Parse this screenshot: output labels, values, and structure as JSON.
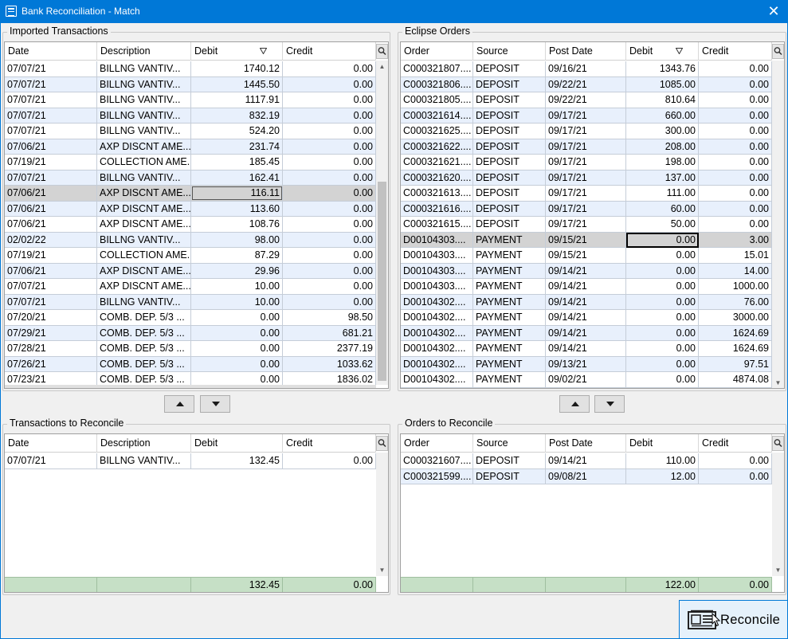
{
  "window": {
    "title": "Bank Reconciliation - Match",
    "close_icon": "close-icon"
  },
  "imported": {
    "legend": "Imported Transactions",
    "columns": [
      "Date",
      "Description",
      "Debit",
      "Credit"
    ],
    "sort_column": "Debit",
    "rows": [
      [
        "07/07/21",
        "BILLNG      VANTIV...",
        "1740.12",
        "0.00"
      ],
      [
        "07/07/21",
        "BILLNG      VANTIV...",
        "1445.50",
        "0.00"
      ],
      [
        "07/07/21",
        "BILLNG      VANTIV...",
        "1117.91",
        "0.00"
      ],
      [
        "07/07/21",
        "BILLNG      VANTIV...",
        "832.19",
        "0.00"
      ],
      [
        "07/07/21",
        "BILLNG      VANTIV...",
        "524.20",
        "0.00"
      ],
      [
        "07/06/21",
        "AXP DISCNT AME...",
        "231.74",
        "0.00"
      ],
      [
        "07/19/21",
        "COLLECTION AME...",
        "185.45",
        "0.00"
      ],
      [
        "07/07/21",
        "BILLNG      VANTIV...",
        "162.41",
        "0.00"
      ],
      [
        "07/06/21",
        "AXP DISCNT AME...",
        "116.11",
        "0.00"
      ],
      [
        "07/06/21",
        "AXP DISCNT AME...",
        "113.60",
        "0.00"
      ],
      [
        "07/06/21",
        "AXP DISCNT AME...",
        "108.76",
        "0.00"
      ],
      [
        "02/02/22",
        "BILLNG      VANTIV...",
        "98.00",
        "0.00"
      ],
      [
        "07/19/21",
        "COLLECTION AME...",
        "87.29",
        "0.00"
      ],
      [
        "07/06/21",
        "AXP DISCNT AME...",
        "29.96",
        "0.00"
      ],
      [
        "07/07/21",
        "AXP DISCNT AME...",
        "10.00",
        "0.00"
      ],
      [
        "07/07/21",
        "BILLNG      VANTIV...",
        "10.00",
        "0.00"
      ],
      [
        "07/20/21",
        "COMB. DEP. 5/3 ...",
        "0.00",
        "98.50"
      ],
      [
        "07/29/21",
        "COMB. DEP. 5/3 ...",
        "0.00",
        "681.21"
      ],
      [
        "07/28/21",
        "COMB. DEP. 5/3 ...",
        "0.00",
        "2377.19"
      ],
      [
        "07/26/21",
        "COMB. DEP. 5/3 ...",
        "0.00",
        "1033.62"
      ],
      [
        "07/23/21",
        "COMB. DEP. 5/3 ...",
        "0.00",
        "1836.02"
      ]
    ],
    "selected_row": 8
  },
  "eclipse": {
    "legend": "Eclipse Orders",
    "columns": [
      "Order",
      "Source",
      "Post Date",
      "Debit",
      "Credit"
    ],
    "sort_column": "Debit",
    "rows": [
      [
        "C000321807....",
        "DEPOSIT",
        "09/16/21",
        "1343.76",
        "0.00"
      ],
      [
        "C000321806....",
        "DEPOSIT",
        "09/22/21",
        "1085.00",
        "0.00"
      ],
      [
        "C000321805....",
        "DEPOSIT",
        "09/22/21",
        "810.64",
        "0.00"
      ],
      [
        "C000321614....",
        "DEPOSIT",
        "09/17/21",
        "660.00",
        "0.00"
      ],
      [
        "C000321625....",
        "DEPOSIT",
        "09/17/21",
        "300.00",
        "0.00"
      ],
      [
        "C000321622....",
        "DEPOSIT",
        "09/17/21",
        "208.00",
        "0.00"
      ],
      [
        "C000321621....",
        "DEPOSIT",
        "09/17/21",
        "198.00",
        "0.00"
      ],
      [
        "C000321620....",
        "DEPOSIT",
        "09/17/21",
        "137.00",
        "0.00"
      ],
      [
        "C000321613....",
        "DEPOSIT",
        "09/17/21",
        "111.00",
        "0.00"
      ],
      [
        "C000321616....",
        "DEPOSIT",
        "09/17/21",
        "60.00",
        "0.00"
      ],
      [
        "C000321615....",
        "DEPOSIT",
        "09/17/21",
        "50.00",
        "0.00"
      ],
      [
        "D00104303....",
        "PAYMENT",
        "09/15/21",
        "0.00",
        "3.00"
      ],
      [
        "D00104303....",
        "PAYMENT",
        "09/15/21",
        "0.00",
        "15.01"
      ],
      [
        "D00104303....",
        "PAYMENT",
        "09/14/21",
        "0.00",
        "14.00"
      ],
      [
        "D00104303....",
        "PAYMENT",
        "09/14/21",
        "0.00",
        "1000.00"
      ],
      [
        "D00104302....",
        "PAYMENT",
        "09/14/21",
        "0.00",
        "76.00"
      ],
      [
        "D00104302....",
        "PAYMENT",
        "09/14/21",
        "0.00",
        "3000.00"
      ],
      [
        "D00104302....",
        "PAYMENT",
        "09/14/21",
        "0.00",
        "1624.69"
      ],
      [
        "D00104302....",
        "PAYMENT",
        "09/14/21",
        "0.00",
        "1624.69"
      ],
      [
        "D00104302....",
        "PAYMENT",
        "09/13/21",
        "0.00",
        "97.51"
      ],
      [
        "D00104302....",
        "PAYMENT",
        "09/02/21",
        "0.00",
        "4874.08"
      ]
    ],
    "selected_row": 11
  },
  "to_reconcile": {
    "legend": "Transactions to Reconcile",
    "columns": [
      "Date",
      "Description",
      "Debit",
      "Credit"
    ],
    "rows": [
      [
        "07/07/21",
        "BILLNG      VANTIV...",
        "132.45",
        "0.00"
      ]
    ],
    "totals": [
      "",
      "",
      "132.45",
      "0.00"
    ]
  },
  "orders_to_reconcile": {
    "legend": "Orders to Reconcile",
    "columns": [
      "Order",
      "Source",
      "Post Date",
      "Debit",
      "Credit"
    ],
    "rows": [
      [
        "C000321607....",
        "DEPOSIT",
        "09/14/21",
        "110.00",
        "0.00"
      ],
      [
        "C000321599....",
        "DEPOSIT",
        "09/08/21",
        "12.00",
        "0.00"
      ]
    ],
    "totals": [
      "",
      "",
      "",
      "122.00",
      "0.00"
    ]
  },
  "buttons": {
    "move_up_icon": "arrow-up-icon",
    "move_down_icon": "arrow-down-icon",
    "reconcile_label": "Reconcile"
  },
  "colors": {
    "titlebar": "#0078d7",
    "row_alt": "#e8f0fc",
    "row_selected": "#d3d3d3",
    "totals_bg": "#c6e0c6"
  }
}
